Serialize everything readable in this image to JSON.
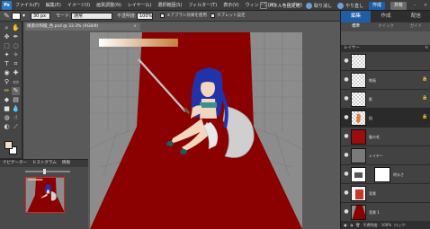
{
  "menubar": {
    "app_logo": "Ps",
    "items": [
      "ファイル(F)",
      "編集(E)",
      "イメージ(I)",
      "画質調整(N)",
      "レイヤー(L)",
      "選択範囲(S)",
      "フィルター(T)",
      "表示(V)",
      "ウィンドウ(W)",
      "ヘルプ(H)"
    ],
    "quick_fix": "パネルを固定化",
    "undo": "取り消し",
    "redo": "やり直し",
    "create": "作成",
    "share": "共有"
  },
  "options": {
    "size_value": "30 px",
    "mode_label": "モード:",
    "mode_value": "通常",
    "opacity_label": "不透明度:",
    "opacity_value": "100%",
    "checkbox1_label": "エアブラシ効果を使用",
    "checkbox2_label": "タブレット設定"
  },
  "document": {
    "tab_title": "風景の和服_色.psd @ 33.3% (RGB/8)",
    "close_glyph": "×"
  },
  "navigator": {
    "tabs": [
      "ナビゲーター",
      "ヒストグラム",
      "情報"
    ]
  },
  "right_panel": {
    "tabs": [
      "編集",
      "作成",
      "配信"
    ],
    "active_tab": "編集",
    "subtabs": [
      "標準",
      "クイック",
      "ガイド"
    ],
    "active_subtab": "標準",
    "layers_title": "レイヤー",
    "layers_menu": "≡",
    "layers": [
      {
        "name": "",
        "selected": false,
        "thumb": "blank"
      },
      {
        "name": "線画",
        "selected": false,
        "thumb": "blank"
      },
      {
        "name": "影",
        "selected": false,
        "thumb": "blank"
      },
      {
        "name": "肌",
        "selected": true,
        "thumb": "skin"
      },
      {
        "name": "髪の毛",
        "selected": false,
        "thumb": "red"
      },
      {
        "name": "レイヤー",
        "selected": false,
        "thumb": "gray"
      },
      {
        "name": "明るさ",
        "selected": false,
        "thumb": "adj"
      },
      {
        "name": "背景",
        "selected": false,
        "thumb": "figure"
      },
      {
        "name": "背景 1",
        "selected": false,
        "thumb": "scene"
      }
    ],
    "footer_items": [
      "不透明度:",
      "100%",
      "ロック:"
    ]
  }
}
